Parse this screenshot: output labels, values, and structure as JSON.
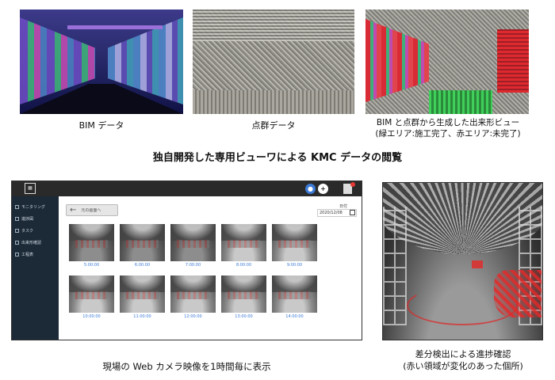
{
  "top_row": {
    "bim_caption": "BIM データ",
    "pointcloud_caption": "点群データ",
    "asbuilt_caption_line1": "BIM と点群から生成した出来形ビュー",
    "asbuilt_caption_line2": "(緑エリア:施工完了、赤エリア:未完了)"
  },
  "heading": "独自開発した専用ビューワによる KMC データの閲覧",
  "viewer": {
    "sidebar_items": [
      {
        "label": "モニタリング",
        "icon": "monitor-icon"
      },
      {
        "label": "進捗図",
        "icon": "chart-icon"
      },
      {
        "label": "タスク",
        "icon": "check-icon"
      },
      {
        "label": "出来形確認",
        "icon": "grid-icon"
      },
      {
        "label": "工程表",
        "icon": "table-icon"
      }
    ],
    "back_label": "元の画面へ",
    "date_label": "日付",
    "date_value": "2020/12/08",
    "thumbnails": [
      {
        "time": "5:00:00",
        "tone": "dark"
      },
      {
        "time": "6:00:00",
        "tone": "dark"
      },
      {
        "time": "7:00:00",
        "tone": "dark"
      },
      {
        "time": "8:00:00",
        "tone": "light"
      },
      {
        "time": "9:00:00",
        "tone": "light"
      },
      {
        "time": "10:00:00",
        "tone": "light"
      },
      {
        "time": "11:00:00",
        "tone": "light"
      },
      {
        "time": "12:00:00",
        "tone": "light"
      },
      {
        "time": "13:00:00",
        "tone": "light"
      },
      {
        "time": "14:00:00",
        "tone": "light"
      }
    ],
    "accent_color": "#3d7bd6",
    "sidebar_color": "#1c2a38"
  },
  "viewer_caption": "現場の Web カメラ映像を1時間毎に表示",
  "pano_caption_line1": "差分検出による進捗確認",
  "pano_caption_line2": "(赤い領域が変化のあった個所)"
}
